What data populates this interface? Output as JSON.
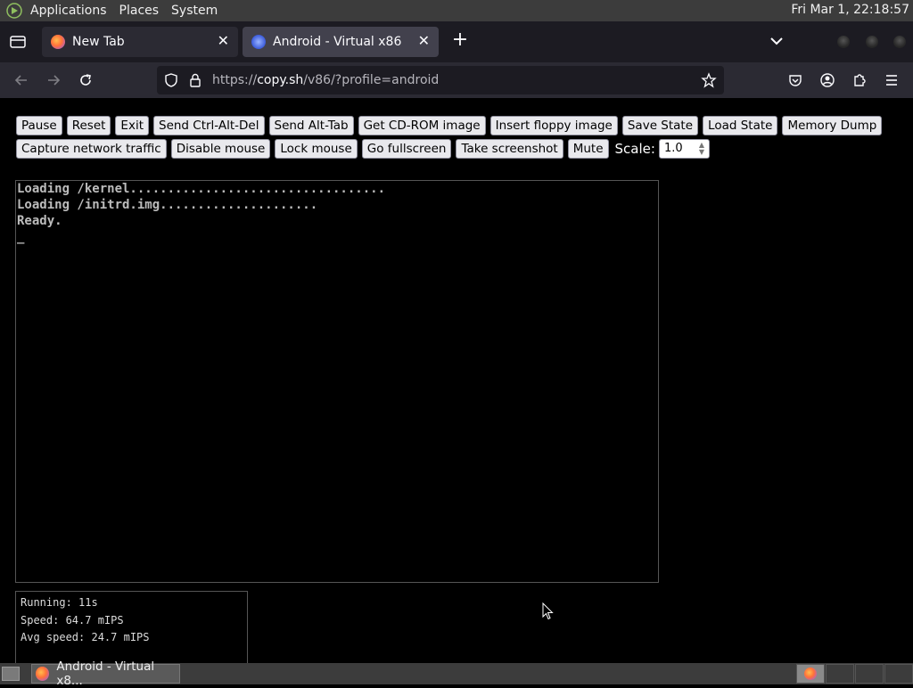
{
  "top_panel": {
    "menus": [
      "Applications",
      "Places",
      "System"
    ],
    "clock": "Fri Mar  1, 22:18:57"
  },
  "browser": {
    "tabs": [
      {
        "title": "New Tab",
        "favicon": "firefox-icon",
        "active": false
      },
      {
        "title": "Android - Virtual x86",
        "favicon": "v86-icon",
        "active": true
      }
    ],
    "url_prefix": "https://",
    "url_domain": "copy.sh",
    "url_path": "/v86/?profile=android"
  },
  "controls": {
    "row1": [
      "Pause",
      "Reset",
      "Exit",
      "Send Ctrl-Alt-Del",
      "Send Alt-Tab",
      "Get CD-ROM image",
      "Insert floppy image",
      "Save State",
      "Load State",
      "Memory Dump"
    ],
    "row2": [
      "Capture network traffic",
      "Disable mouse",
      "Lock mouse",
      "Go fullscreen",
      "Take screenshot",
      "Mute"
    ],
    "scale_label": "Scale:",
    "scale_value": "1.0"
  },
  "screen": {
    "lines": [
      "Loading /kernel..................................",
      "Loading /initrd.img.....................",
      "Ready.",
      "_"
    ]
  },
  "stats": {
    "running": "Running: 11s",
    "speed": "Speed: 64.7 mIPS",
    "avg_speed": "Avg speed: 24.7 mIPS"
  },
  "taskbar": {
    "task_title": "Android - Virtual x8..."
  },
  "colors": {
    "panel": "#3c3c3c",
    "tabbar": "#1c1b22",
    "navbar": "#2b2a33",
    "active_tab": "#42414d",
    "button_bg": "#e9e9ed"
  }
}
